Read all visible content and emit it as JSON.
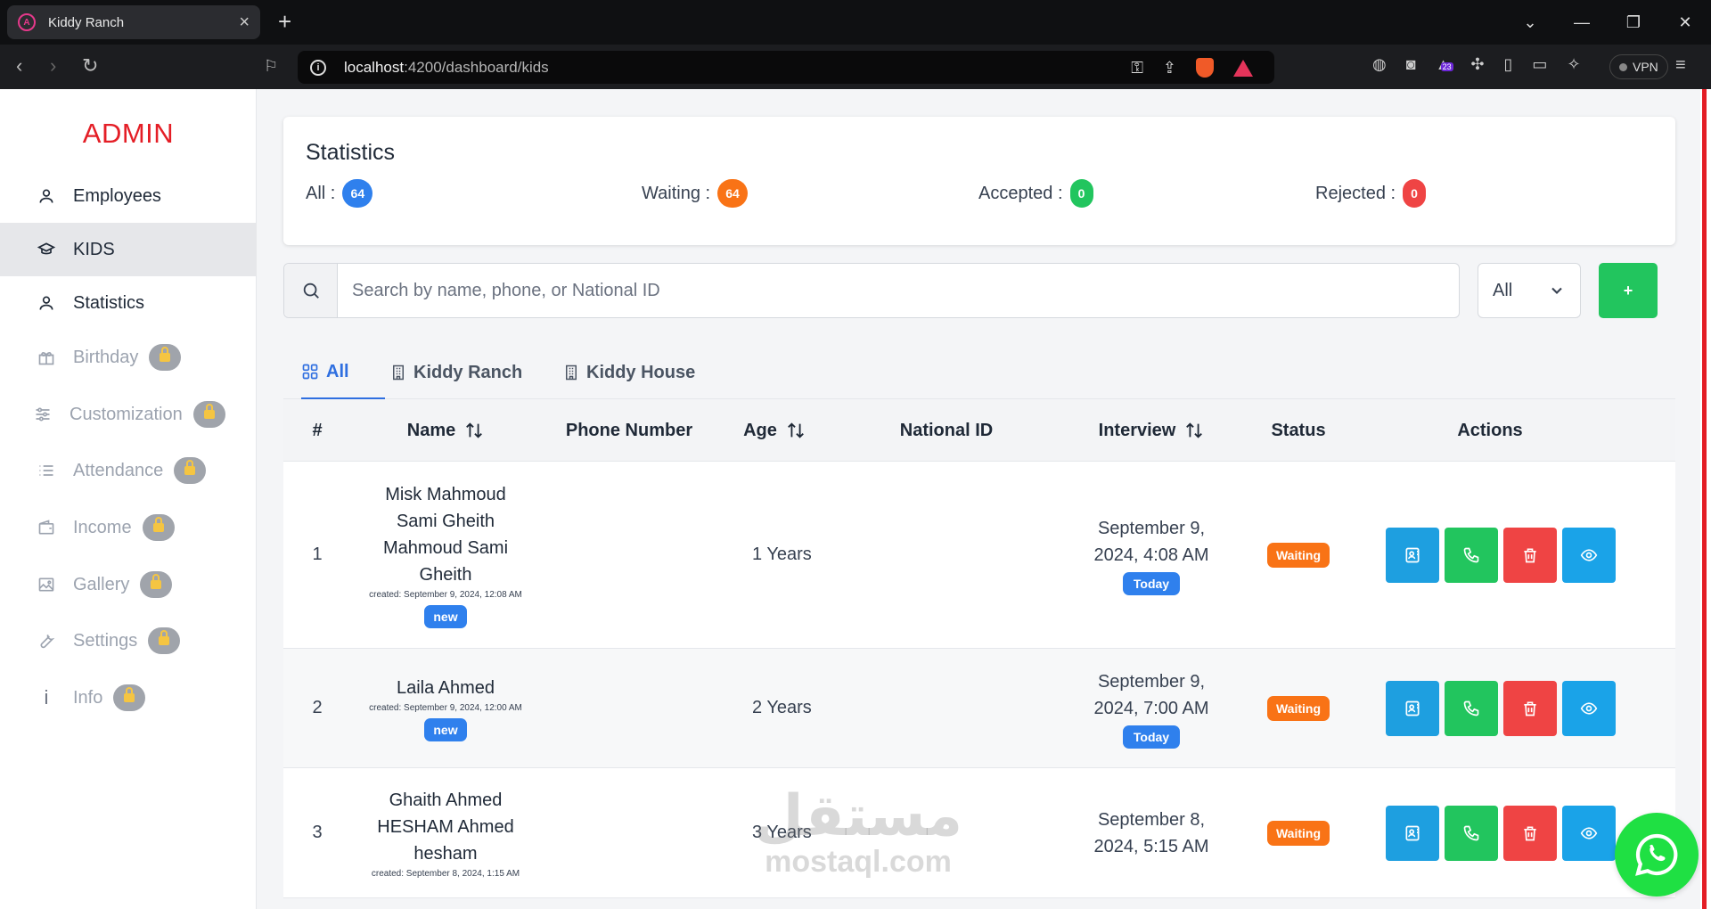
{
  "browser": {
    "tab_title": "Kiddy Ranch",
    "url_host": "localhost",
    "url_path": ":4200/dashboard/kids",
    "vpn_label": "VPN",
    "badge_count": "23"
  },
  "sidebar": {
    "brand": "ADMIN",
    "items": [
      {
        "label": "Employees",
        "icon": "user-icon",
        "locked": false,
        "active": false
      },
      {
        "label": "KIDS",
        "icon": "graduation-cap-icon",
        "locked": false,
        "active": true
      },
      {
        "label": "Statistics",
        "icon": "user-icon",
        "locked": false,
        "active": false
      },
      {
        "label": "Birthday",
        "icon": "gift-icon",
        "locked": true,
        "active": false
      },
      {
        "label": "Customization",
        "icon": "sliders-icon",
        "locked": true,
        "active": false
      },
      {
        "label": "Attendance",
        "icon": "list-icon",
        "locked": true,
        "active": false
      },
      {
        "label": "Income",
        "icon": "wallet-icon",
        "locked": true,
        "active": false
      },
      {
        "label": "Gallery",
        "icon": "image-icon",
        "locked": true,
        "active": false
      },
      {
        "label": "Settings",
        "icon": "wrench-icon",
        "locked": true,
        "active": false
      },
      {
        "label": "Info",
        "icon": "info-icon",
        "locked": true,
        "active": false
      }
    ]
  },
  "statistics": {
    "title": "Statistics",
    "all_label": "All :",
    "all_count": "64",
    "waiting_label": "Waiting :",
    "waiting_count": "64",
    "accepted_label": "Accepted :",
    "accepted_count": "0",
    "rejected_label": "Rejected :",
    "rejected_count": "0"
  },
  "colors": {
    "brand": "#e41e26",
    "all": "#2f80ed",
    "waiting": "#f97316",
    "accepted": "#22c55e",
    "rejected": "#ef4444"
  },
  "search": {
    "placeholder": "Search by name, phone, or National ID",
    "filter_value": "All",
    "add_label": "+"
  },
  "tabs": [
    {
      "label": "All",
      "active": true
    },
    {
      "label": "Kiddy Ranch",
      "active": false
    },
    {
      "label": "Kiddy House",
      "active": false
    }
  ],
  "table": {
    "headers": {
      "index": "#",
      "name": "Name",
      "phone": "Phone Number",
      "age": "Age",
      "national_id": "National ID",
      "interview": "Interview",
      "status": "Status",
      "actions": "Actions"
    },
    "rows": [
      {
        "index": "1",
        "name_lines": [
          "Misk Mahmoud",
          "Sami Gheith",
          "Mahmoud Sami",
          "Gheith"
        ],
        "created": "created: September 9, 2024, 12:08 AM",
        "new_badge": "new",
        "phone": "",
        "age": "1 Years",
        "national_id": "",
        "interview_lines": [
          "September 9,",
          "2024, 4:08 AM"
        ],
        "today_badge": "Today",
        "status": "Waiting"
      },
      {
        "index": "2",
        "name_lines": [
          "Laila Ahmed"
        ],
        "created": "created: September 9, 2024, 12:00 AM",
        "new_badge": "new",
        "phone": "",
        "age": "2 Years",
        "national_id": "",
        "interview_lines": [
          "September 9,",
          "2024, 7:00 AM"
        ],
        "today_badge": "Today",
        "status": "Waiting"
      },
      {
        "index": "3",
        "name_lines": [
          "Ghaith Ahmed",
          "HESHAM Ahmed",
          "hesham"
        ],
        "created": "created: September 8, 2024, 1:15 AM",
        "new_badge": "",
        "phone": "",
        "age": "3 Years",
        "national_id": "",
        "interview_lines": [
          "September 8,",
          "2024, 5:15 AM"
        ],
        "today_badge": "",
        "status": "Waiting"
      }
    ]
  },
  "watermark": {
    "arabic": "مستقل",
    "latin": "mostaql.com"
  }
}
